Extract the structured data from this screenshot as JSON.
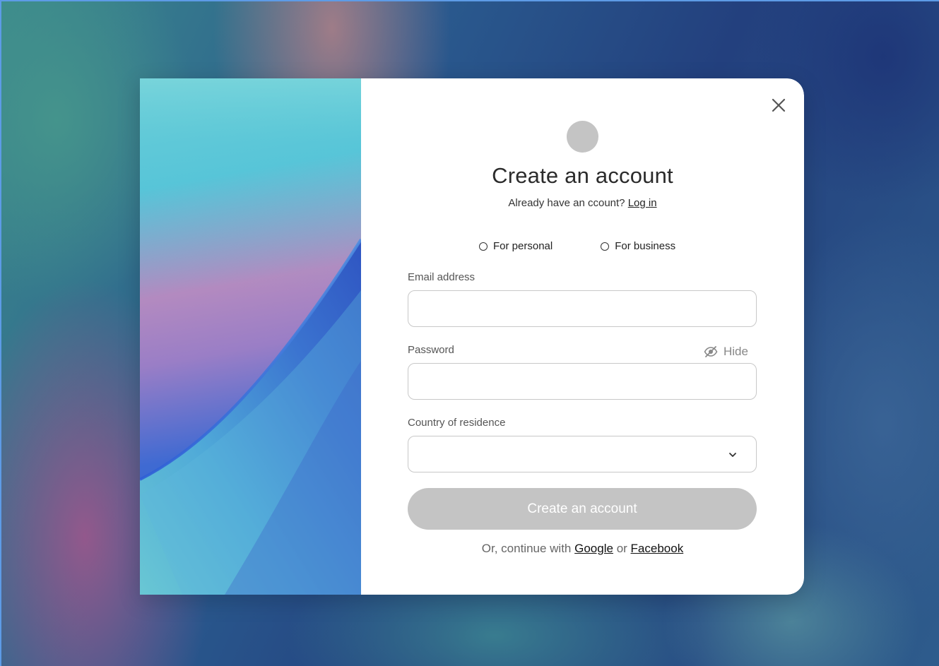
{
  "dialog": {
    "title": "Create an account",
    "subtitle_prefix": "Already have an ccount?",
    "login_link": "Log in",
    "account_types": [
      {
        "label": "For personal",
        "selected": false
      },
      {
        "label": "For business",
        "selected": false
      }
    ],
    "email": {
      "label": "Email address",
      "value": "",
      "placeholder": ""
    },
    "password": {
      "label": "Password",
      "value": "",
      "placeholder": "",
      "toggle_label": "Hide"
    },
    "country": {
      "label": "Country of residence",
      "value": ""
    },
    "submit_label": "Create an account",
    "social": {
      "prefix": "Or, continue with",
      "google": "Google",
      "separator": "or",
      "facebook": "Facebook"
    }
  },
  "colors": {
    "submit_disabled": "#c4c4c4",
    "avatar_placeholder": "#c4c4c4",
    "input_border": "#c8c8c8",
    "title_text": "#2b2b2b"
  },
  "icons": {
    "close": "close-icon",
    "password_visibility": "eye-slash-icon",
    "select_caret": "chevron-down-icon"
  }
}
